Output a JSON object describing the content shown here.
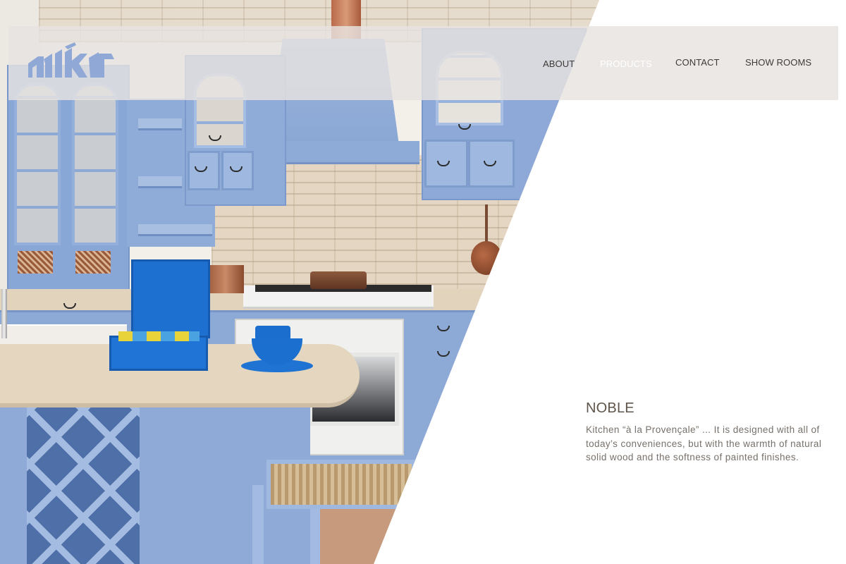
{
  "nav": {
    "about": "ABOUT",
    "products": "PRODUCTS",
    "contact": "CONTACT",
    "showrooms": "SHOW ROOMS",
    "active_item": "products"
  },
  "logo": {
    "icon": "brand-logo-icon",
    "color": "#8fa8d6"
  },
  "product": {
    "title": "NOBLE",
    "description": "Kitchen “à la Provençale” ... It is designed with all of today’s conveniences, but with the warmth of natural solid wood and the softness of painted finishes."
  },
  "hero": {
    "icon": "kitchen-photo"
  },
  "colors": {
    "header_bar": "#e7e3e0",
    "nav_text": "#3e3a36",
    "nav_active": "#ffffff",
    "title": "#5e544a",
    "body_text": "#77706a",
    "cabinet_blue": "#8da9d6"
  }
}
